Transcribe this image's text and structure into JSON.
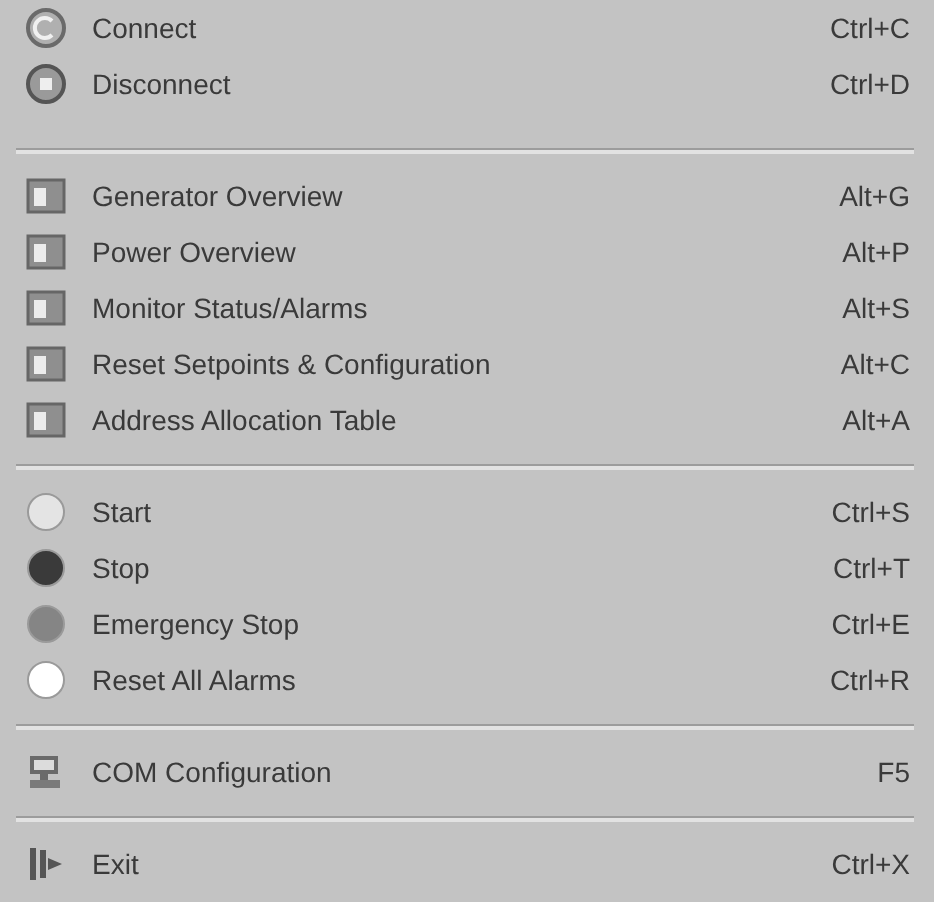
{
  "menu": {
    "groups": [
      {
        "items": [
          {
            "kind": "connect",
            "label": "Connect",
            "shortcut": "Ctrl+C"
          },
          {
            "kind": "disconnect",
            "label": "Disconnect",
            "shortcut": "Ctrl+D"
          }
        ]
      },
      {
        "items": [
          {
            "kind": "window",
            "label": "Generator Overview",
            "shortcut": "Alt+G"
          },
          {
            "kind": "window",
            "label": "Power Overview",
            "shortcut": "Alt+P"
          },
          {
            "kind": "window",
            "label": "Monitor Status/Alarms",
            "shortcut": "Alt+S"
          },
          {
            "kind": "window",
            "label": "Reset Setpoints & Configuration",
            "shortcut": "Alt+C"
          },
          {
            "kind": "window",
            "label": "Address Allocation Table",
            "shortcut": "Alt+A"
          }
        ]
      },
      {
        "items": [
          {
            "kind": "dot",
            "color": "#e4e4e4",
            "label": "Start",
            "shortcut": "Ctrl+S"
          },
          {
            "kind": "dot",
            "color": "#3a3a3a",
            "label": "Stop",
            "shortcut": "Ctrl+T"
          },
          {
            "kind": "dot",
            "color": "#858585",
            "label": "Emergency Stop",
            "shortcut": "Ctrl+E"
          },
          {
            "kind": "dot",
            "color": "#ffffff",
            "label": "Reset All Alarms",
            "shortcut": "Ctrl+R"
          }
        ]
      },
      {
        "items": [
          {
            "kind": "computer",
            "label": "COM Configuration",
            "shortcut": "F5"
          }
        ]
      },
      {
        "items": [
          {
            "kind": "exit",
            "label": "Exit",
            "shortcut": "Ctrl+X"
          }
        ]
      }
    ]
  }
}
